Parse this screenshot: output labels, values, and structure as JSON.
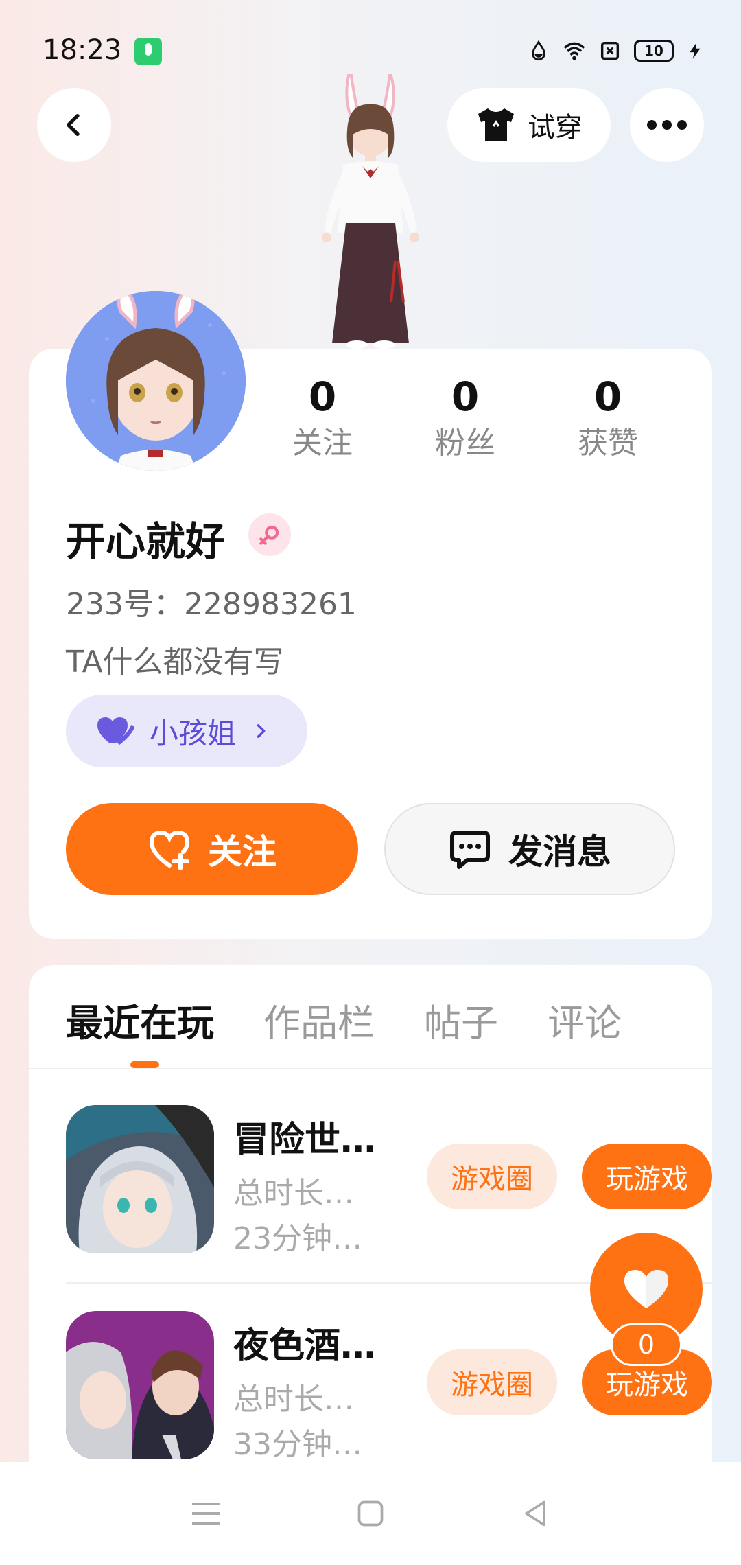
{
  "status_bar": {
    "time": "18:23",
    "battery": "10",
    "icons": [
      "mic-icon",
      "data-saver-icon",
      "wifi-icon",
      "sim-icon",
      "battery-icon",
      "charging-icon"
    ]
  },
  "header": {
    "try_on_label": "试穿",
    "back_icon": "chevron-left-icon",
    "more_icon": "more-dots-icon"
  },
  "profile": {
    "nickname": "开心就好",
    "gender": "female",
    "user_id": "233号：228983261",
    "bio": "TA什么都没有写",
    "tag_label": "小孩姐",
    "stats": [
      {
        "value": "0",
        "label": "关注"
      },
      {
        "value": "0",
        "label": "粉丝"
      },
      {
        "value": "0",
        "label": "获赞"
      }
    ],
    "follow_label": "关注",
    "message_label": "发消息"
  },
  "tabs": [
    {
      "label": "最近在玩",
      "active": true
    },
    {
      "label": "作品栏",
      "active": false
    },
    {
      "label": "帖子",
      "active": false
    },
    {
      "label": "评论",
      "active": false
    }
  ],
  "games": [
    {
      "title": "冒险世…",
      "sub1": "总时长…",
      "sub2": "23分钟…",
      "circle_label": "游戏圈",
      "play_label": "玩游戏"
    },
    {
      "title": "夜色酒…",
      "sub1": "总时长…",
      "sub2": "33分钟…",
      "circle_label": "游戏圈",
      "play_label": "玩游戏"
    }
  ],
  "like": {
    "count": "0"
  },
  "colors": {
    "accent": "#ff7213",
    "accent_light": "#fde8de",
    "tag_bg": "#e9e8fb",
    "tag_text": "#5b4bd6"
  }
}
